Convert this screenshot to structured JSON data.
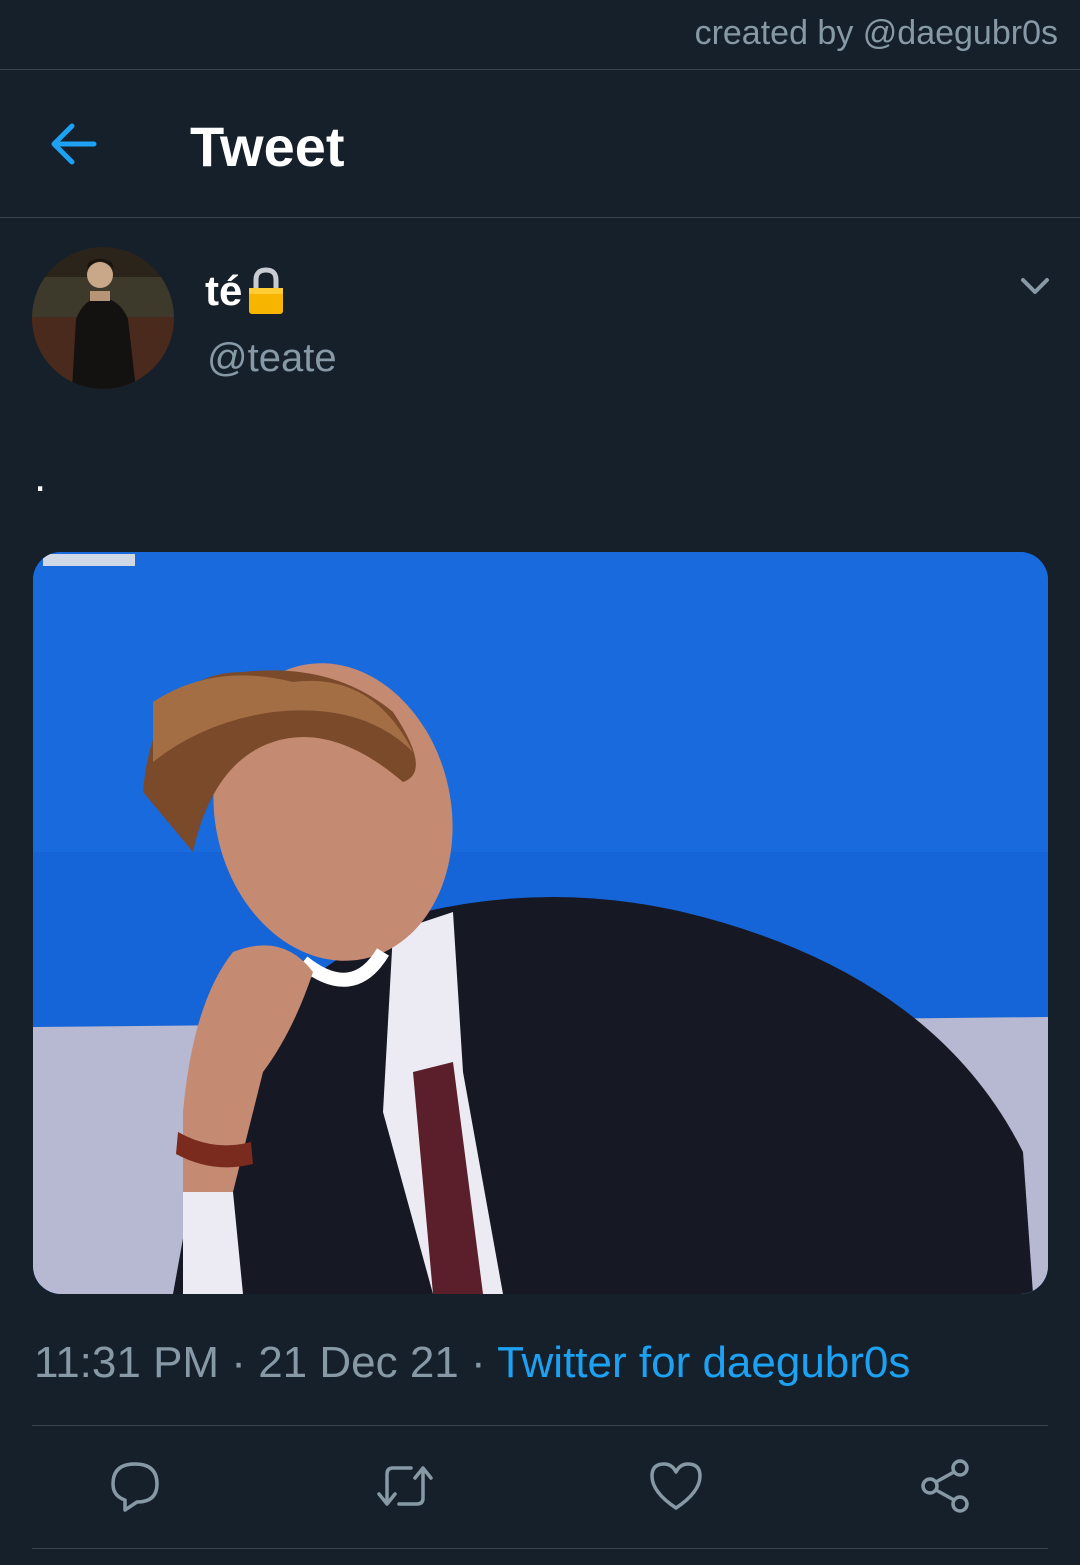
{
  "credit": {
    "text": "created by @daegubr0s"
  },
  "header": {
    "title": "Tweet",
    "back_icon": "arrow-left-icon"
  },
  "tweet": {
    "author": {
      "display_name": "té",
      "lock_emoji": "🔒",
      "handle": "@teate"
    },
    "text": ".",
    "media_alt": "",
    "meta": {
      "time": "11:31 PM",
      "separator1": " · ",
      "date": "21 Dec 21",
      "separator2": " · ",
      "source": "Twitter for daegubr0s"
    }
  },
  "actions": [
    {
      "icon": "reply-icon"
    },
    {
      "icon": "retweet-icon"
    },
    {
      "icon": "like-icon"
    },
    {
      "icon": "share-icon"
    }
  ],
  "colors": {
    "background": "#15202b",
    "accent": "#1da1f2",
    "secondary_text": "#8899a6",
    "divider": "#38444d"
  }
}
